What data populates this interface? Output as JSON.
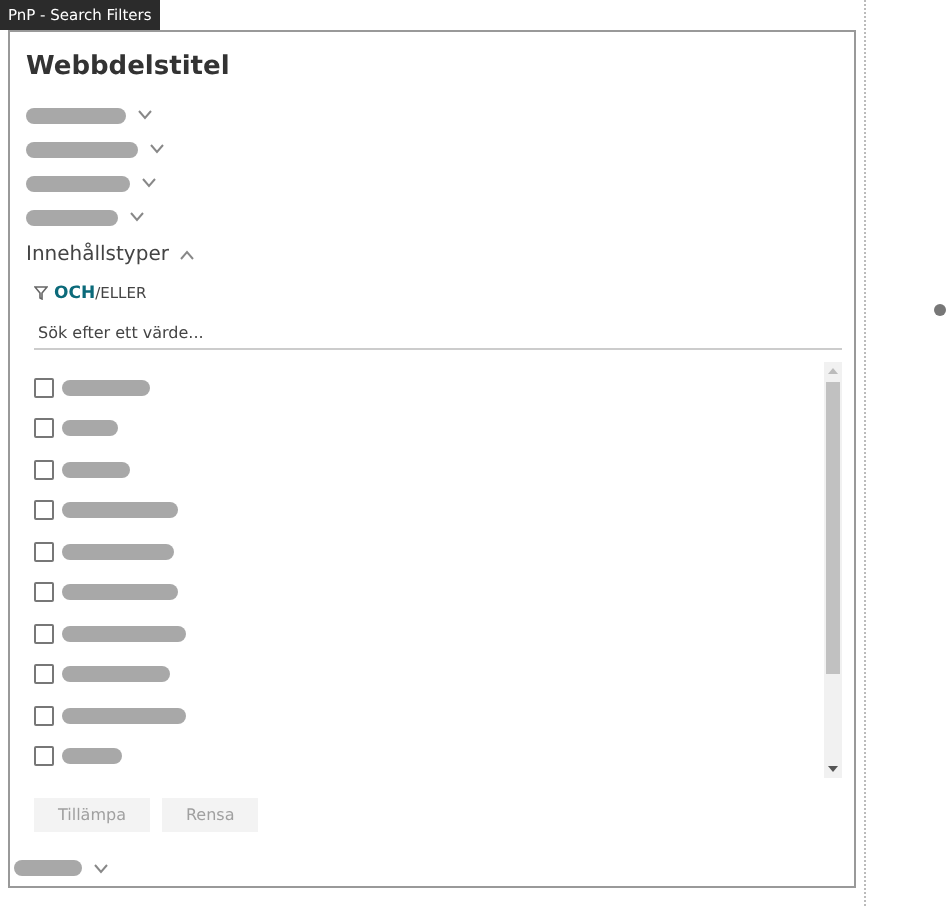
{
  "tab": {
    "label": "PnP - Search Filters"
  },
  "webpart": {
    "title": "Webbdelstitel"
  },
  "filters_before": [
    {
      "expanded": false
    },
    {
      "expanded": false
    },
    {
      "expanded": false
    },
    {
      "expanded": false
    }
  ],
  "content_types": {
    "label": "Innehållstyper",
    "expanded": true,
    "operator_and": "OCH",
    "operator_separator": "/",
    "operator_or": "ELLER",
    "search": {
      "placeholder": "Sök efter ett värde..."
    },
    "options": [
      {
        "checked": false
      },
      {
        "checked": false
      },
      {
        "checked": false
      },
      {
        "checked": false
      },
      {
        "checked": false
      },
      {
        "checked": false
      },
      {
        "checked": false
      },
      {
        "checked": false
      },
      {
        "checked": false
      },
      {
        "checked": false
      }
    ],
    "buttons": [
      {
        "label": "Tillämpa",
        "disabled": true
      },
      {
        "label": "Rensa",
        "disabled": true
      }
    ]
  },
  "filters_after": [
    {
      "expanded": false
    }
  ]
}
